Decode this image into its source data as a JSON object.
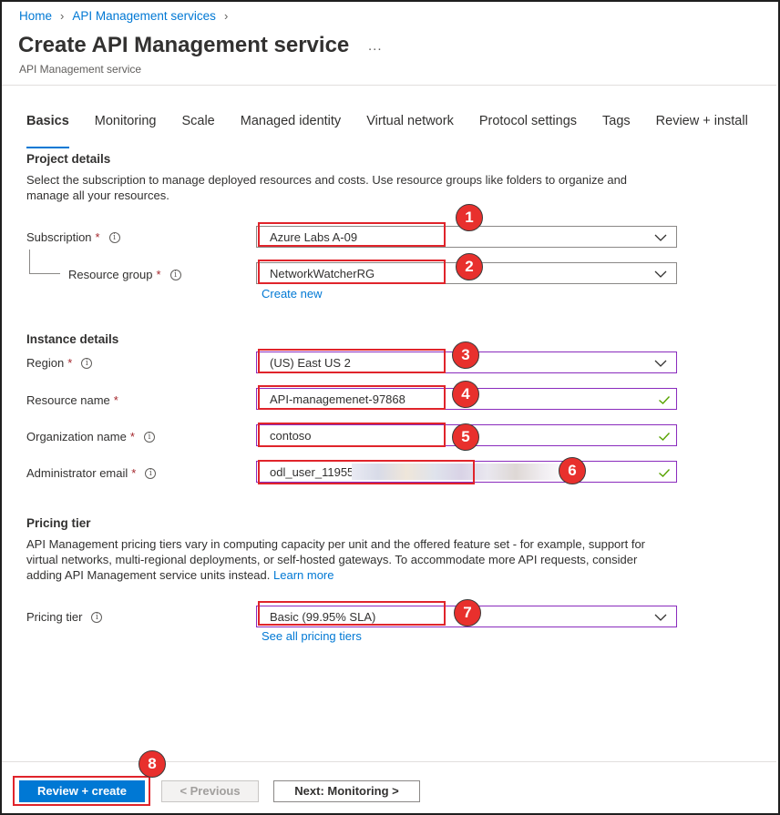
{
  "breadcrumb": [
    {
      "label": "Home"
    },
    {
      "label": "API Management services"
    }
  ],
  "page": {
    "title": "Create API Management service",
    "more": "...",
    "subtitle": "API Management service"
  },
  "tabs": [
    {
      "label": "Basics",
      "active": true
    },
    {
      "label": "Monitoring"
    },
    {
      "label": "Scale"
    },
    {
      "label": "Managed identity"
    },
    {
      "label": "Virtual network"
    },
    {
      "label": "Protocol settings"
    },
    {
      "label": "Tags"
    },
    {
      "label": "Review + install"
    }
  ],
  "project": {
    "title": "Project details",
    "description": "Select the subscription to manage deployed resources and costs. Use resource groups like folders to organize and manage all your resources.",
    "subscription": {
      "label": "Subscription",
      "value": "Azure Labs A-09"
    },
    "resource_group": {
      "label": "Resource group",
      "value": "NetworkWatcherRG",
      "create_new": "Create new"
    }
  },
  "instance": {
    "title": "Instance details",
    "region": {
      "label": "Region",
      "value": "(US) East US 2"
    },
    "resource_name": {
      "label": "Resource name",
      "value": "API-managemenet-97868"
    },
    "organization_name": {
      "label": "Organization name",
      "value": "contoso"
    },
    "admin_email": {
      "label": "Administrator email",
      "value": "odl_user_11955"
    }
  },
  "pricing": {
    "title": "Pricing tier",
    "description": "API Management pricing tiers vary in computing capacity per unit and the offered feature set - for example, support for virtual networks, multi-regional deployments, or self-hosted gateways. To accommodate more API requests, consider adding API Management service units instead.",
    "learn_more": "Learn more",
    "tier": {
      "label": "Pricing tier",
      "value": "Basic (99.95% SLA)",
      "see_all": "See all pricing tiers"
    }
  },
  "footer": {
    "review_create": "Review + create",
    "previous": "< Previous",
    "next": "Next: Monitoring >"
  },
  "annotations": [
    "1",
    "2",
    "3",
    "4",
    "5",
    "6",
    "7",
    "8"
  ],
  "colors": {
    "accent": "#0078d4",
    "required": "#a4262c",
    "highlight": "#e0242b",
    "valid": "#57a300"
  },
  "icons": {
    "info": "info-icon",
    "dropdown": "chevron-down-icon",
    "valid": "checkmark-icon",
    "separator": "chevron-right-icon"
  }
}
